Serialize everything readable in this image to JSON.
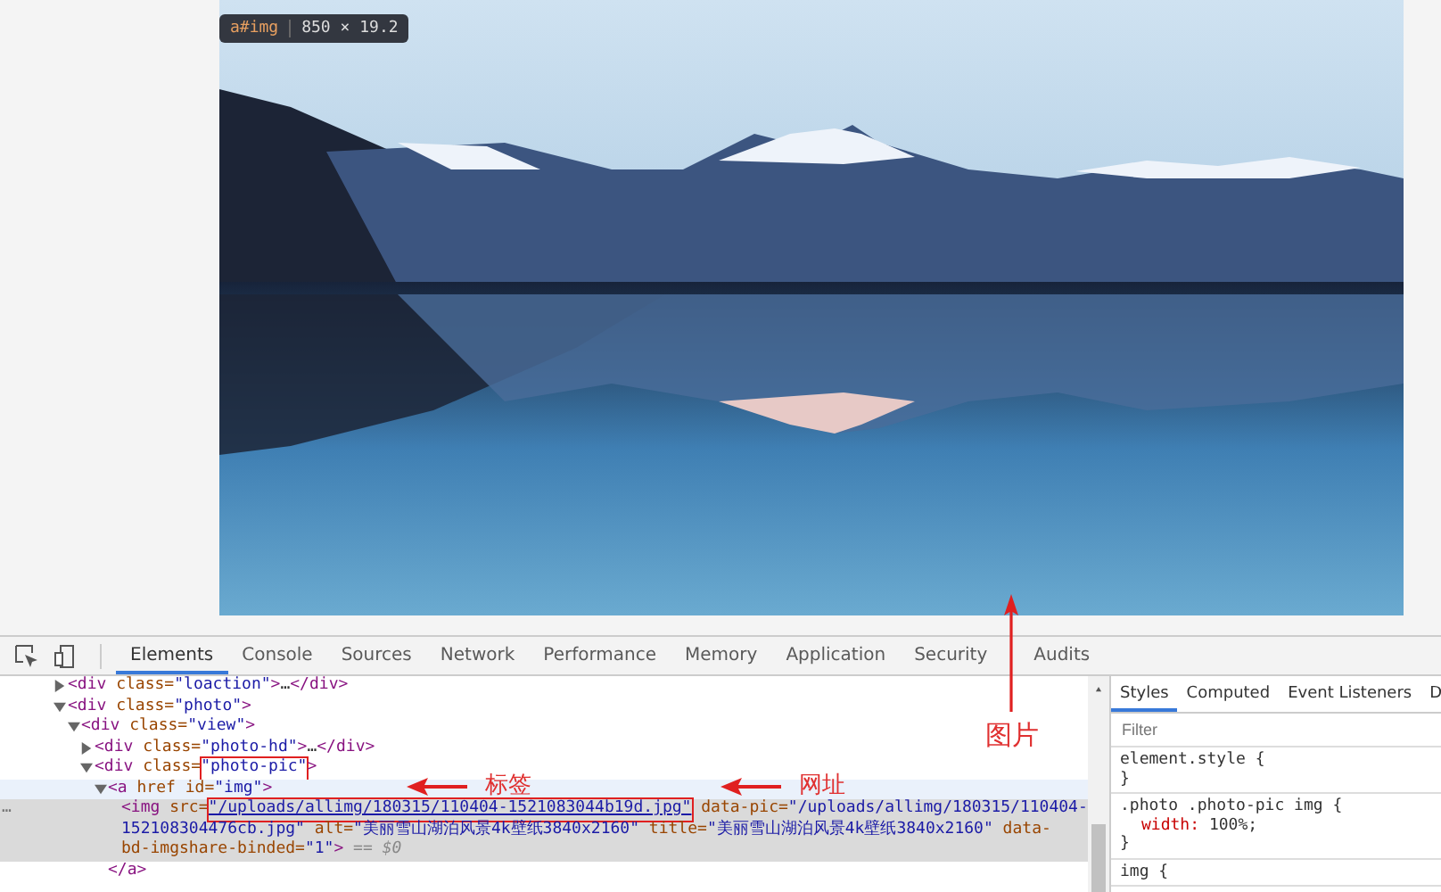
{
  "tooltip": {
    "selector": "a#img",
    "size": "850 × 19.2"
  },
  "devtools_tabs": [
    {
      "label": "Elements",
      "selected": true
    },
    {
      "label": "Console",
      "selected": false
    },
    {
      "label": "Sources",
      "selected": false
    },
    {
      "label": "Network",
      "selected": false
    },
    {
      "label": "Performance",
      "selected": false
    },
    {
      "label": "Memory",
      "selected": false
    },
    {
      "label": "Application",
      "selected": false
    },
    {
      "label": "Security",
      "selected": false
    },
    {
      "label": "Audits",
      "selected": false
    }
  ],
  "toolbar_annotation": {
    "kind": "arrow-up",
    "text": "图片"
  },
  "dom_tree": [
    {
      "expanded": false,
      "selected": false,
      "hovered": false,
      "segments": [
        {
          "kind": "tag",
          "text": "<div "
        },
        {
          "kind": "attr-name",
          "text": "class="
        },
        {
          "kind": "attr-value",
          "text": "\"loaction\""
        },
        {
          "kind": "tag",
          "text": ">"
        },
        {
          "kind": "plain",
          "text": "…"
        },
        {
          "kind": "tag",
          "text": "</div>"
        }
      ]
    },
    {
      "expanded": true,
      "selected": false,
      "hovered": false,
      "segments": [
        {
          "kind": "tag",
          "text": "<div "
        },
        {
          "kind": "attr-name",
          "text": "class="
        },
        {
          "kind": "attr-value",
          "text": "\"photo\""
        },
        {
          "kind": "tag",
          "text": ">"
        }
      ],
      "children": [
        {
          "expanded": true,
          "selected": false,
          "hovered": false,
          "segments": [
            {
              "kind": "tag",
              "text": "<div "
            },
            {
              "kind": "attr-name",
              "text": "class="
            },
            {
              "kind": "attr-value",
              "text": "\"view\""
            },
            {
              "kind": "tag",
              "text": ">"
            }
          ],
          "children": [
            {
              "expanded": false,
              "selected": false,
              "hovered": false,
              "segments": [
                {
                  "kind": "tag",
                  "text": "<div "
                },
                {
                  "kind": "attr-name",
                  "text": "class="
                },
                {
                  "kind": "attr-value",
                  "text": "\"photo-hd\""
                },
                {
                  "kind": "tag",
                  "text": ">"
                },
                {
                  "kind": "plain",
                  "text": "…"
                },
                {
                  "kind": "tag",
                  "text": "</div>"
                }
              ]
            },
            {
              "expanded": true,
              "selected": false,
              "hovered": false,
              "segments": [
                {
                  "kind": "tag",
                  "text": "<div "
                },
                {
                  "kind": "attr-name",
                  "text": "class="
                },
                {
                  "kind": "attr-value",
                  "text": "\"photo-pic\"",
                  "framed": true
                },
                {
                  "kind": "tag",
                  "text": ">"
                }
              ],
              "children": [
                {
                  "expanded": true,
                  "selected": false,
                  "hovered": true,
                  "segments": [
                    {
                      "kind": "tag",
                      "text": "<a "
                    },
                    {
                      "kind": "attr-name",
                      "text": "href id="
                    },
                    {
                      "kind": "attr-value",
                      "text": "\"img\""
                    },
                    {
                      "kind": "tag",
                      "text": ">"
                    }
                  ],
                  "annotations": [
                    {
                      "kind": "arrow-left",
                      "text": "标签"
                    },
                    {
                      "kind": "arrow-left",
                      "text": "网址"
                    }
                  ],
                  "closing": "</a>",
                  "children": [
                    {
                      "selected": true,
                      "gutter": "…",
                      "segments": [
                        {
                          "kind": "tag",
                          "text": "<img "
                        },
                        {
                          "kind": "attr-name",
                          "text": "src="
                        },
                        {
                          "kind": "link",
                          "text": "\"/uploads/allimg/180315/110404-1521083044b19d.jpg\"",
                          "framed": true
                        },
                        {
                          "kind": "attr-name",
                          "text": " data-pic="
                        },
                        {
                          "kind": "attr-value",
                          "text": "\"/uploads/allimg/180315/110404-"
                        },
                        {
                          "kind": "attr-value",
                          "text": "152108304476cb.jpg\""
                        },
                        {
                          "kind": "attr-name",
                          "text": " alt="
                        },
                        {
                          "kind": "attr-value",
                          "text": "\"美丽雪山湖泊风景4k壁纸3840x2160\""
                        },
                        {
                          "kind": "attr-name",
                          "text": " title="
                        },
                        {
                          "kind": "attr-value",
                          "text": "\"美丽雪山湖泊风景4k壁纸3840x2160\""
                        },
                        {
                          "kind": "attr-name",
                          "text": " data-"
                        },
                        {
                          "kind": "attr-name",
                          "text": "bd-imgshare-binded="
                        },
                        {
                          "kind": "attr-value",
                          "text": "\"1\""
                        },
                        {
                          "kind": "tag",
                          "text": ">"
                        },
                        {
                          "kind": "note",
                          "text": " == $0"
                        }
                      ]
                    }
                  ]
                }
              ]
            }
          ]
        }
      ]
    }
  ],
  "styles_tabs": [
    {
      "label": "Styles",
      "selected": true
    },
    {
      "label": "Computed",
      "selected": false
    },
    {
      "label": "Event Listeners",
      "selected": false
    },
    {
      "label": "D",
      "selected": false
    }
  ],
  "filter": {
    "placeholder": "Filter"
  },
  "style_rules": [
    {
      "selector": "element.style {",
      "close": "}"
    },
    {
      "selector": ".photo .photo-pic img {",
      "declarations": [
        {
          "property": "width:",
          "value": "100%;"
        }
      ],
      "close": "}"
    },
    {
      "selector": "img {"
    }
  ]
}
